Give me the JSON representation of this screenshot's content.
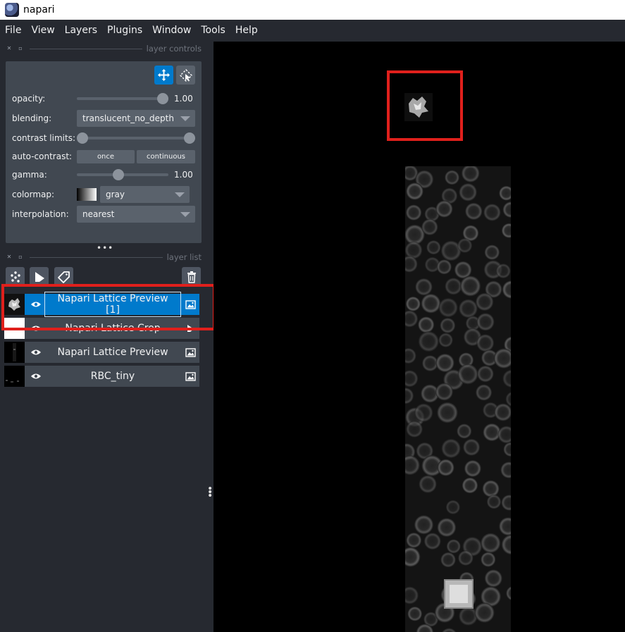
{
  "window": {
    "title": "napari"
  },
  "menu": [
    "File",
    "View",
    "Layers",
    "Plugins",
    "Window",
    "Tools",
    "Help"
  ],
  "layer_controls": {
    "dock_label": "layer controls",
    "opacity_label": "opacity:",
    "opacity_value": "1.00",
    "opacity_fraction": 1.0,
    "blending_label": "blending:",
    "blending_value": "translucent_no_depth",
    "contrast_label": "contrast limits:",
    "contrast_range": [
      0.0,
      1.0
    ],
    "autocontrast_label": "auto-contrast:",
    "autocontrast_once": "once",
    "autocontrast_continuous": "continuous",
    "gamma_label": "gamma:",
    "gamma_value": "1.00",
    "gamma_fraction": 0.45,
    "colormap_label": "colormap:",
    "colormap_value": "gray",
    "interpolation_label": "interpolation:",
    "interpolation_value": "nearest",
    "accent_color": "#007acc"
  },
  "layer_list": {
    "dock_label": "layer list",
    "layers": [
      {
        "name": "Napari Lattice Preview [1]",
        "selected": true
      },
      {
        "name": "Napari Lattice Crop",
        "selected": false
      },
      {
        "name": "Napari Lattice Preview",
        "selected": false
      },
      {
        "name": "RBC_tiny",
        "selected": false
      }
    ]
  },
  "annotation_color": "#e0201c"
}
